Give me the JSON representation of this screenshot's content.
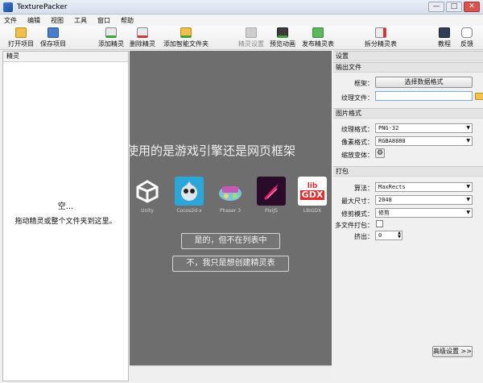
{
  "window": {
    "title": "TexturePacker",
    "minimize": "—",
    "maximize": "□",
    "close": "✕"
  },
  "menu": [
    "文件",
    "编辑",
    "视图",
    "工具",
    "窗口",
    "帮助"
  ],
  "toolbar": {
    "open": "打开项目",
    "save": "保存项目",
    "add_sprite": "添加精灵",
    "remove_sprite": "删除精灵",
    "add_smart_folder": "添加智能文件夹",
    "sprite_settings": "精灵设置",
    "preview_anim": "预览动画",
    "publish": "发布精灵表",
    "split": "拆分精灵表",
    "tutorial": "教程",
    "feedback": "反馈"
  },
  "sprites_panel": {
    "title": "精灵",
    "empty_title": "空...",
    "empty_hint": "拖动精灵或整个文件夹到这里。"
  },
  "center": {
    "question": "使用的是游戏引擎还是网页框架",
    "engines": [
      {
        "name": "Unity"
      },
      {
        "name": "Cocos2d-x"
      },
      {
        "name": "Phaser 3"
      },
      {
        "name": "PixiJS"
      },
      {
        "name": "LibGDX",
        "logo_text_top": "lib",
        "logo_text_bottom": "GDX"
      }
    ],
    "btn_yes": "是的，但不在列表中",
    "btn_no": "不，我只是想创建精灵表"
  },
  "settings": {
    "title": "设置",
    "output": {
      "header": "输出文件",
      "framework_label": "框架：",
      "framework_button": "选择数据格式",
      "texture_label": "纹理文件：",
      "texture_value": ""
    },
    "image": {
      "header": "图片格式",
      "format_label": "纹理格式：",
      "format_value": "PNG-32",
      "pixel_label": "像素格式：",
      "pixel_value": "RGBA8888",
      "scale_label": "缩放变体："
    },
    "packing": {
      "header": "打包",
      "algorithm_label": "算法：",
      "algorithm_value": "MaxRects",
      "maxsize_label": "最大尺寸：",
      "maxsize_value": "2048",
      "trim_label": "修剪模式：",
      "trim_value": "修剪",
      "multipack_label": "多文件打包：",
      "extrude_label": "挤出：",
      "extrude_value": "0"
    },
    "advanced": "高级设置 >>"
  }
}
